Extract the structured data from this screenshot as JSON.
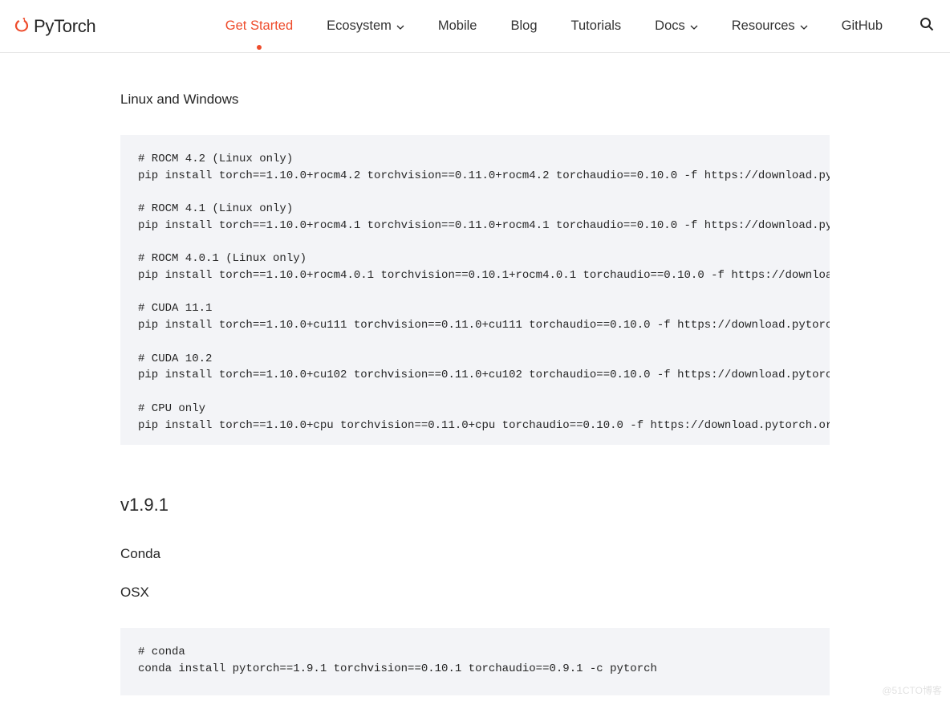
{
  "brand": "PyTorch",
  "nav": {
    "get_started": "Get Started",
    "ecosystem": "Ecosystem",
    "mobile": "Mobile",
    "blog": "Blog",
    "tutorials": "Tutorials",
    "docs": "Docs",
    "resources": "Resources",
    "github": "GitHub"
  },
  "sections": {
    "linux_windows": "Linux and Windows",
    "v191": "v1.9.1",
    "conda": "Conda",
    "osx": "OSX"
  },
  "code_block_1": "# ROCM 4.2 (Linux only)\npip install torch==1.10.0+rocm4.2 torchvision==0.11.0+rocm4.2 torchaudio==0.10.0 -f https://download.pytorch.org/whl/torch_stable.html\n\n# ROCM 4.1 (Linux only)\npip install torch==1.10.0+rocm4.1 torchvision==0.11.0+rocm4.1 torchaudio==0.10.0 -f https://download.pytorch.org/whl/torch_stable.html\n\n# ROCM 4.0.1 (Linux only)\npip install torch==1.10.0+rocm4.0.1 torchvision==0.10.1+rocm4.0.1 torchaudio==0.10.0 -f https://download.pytorch.org/whl/torch_stable.html\n\n# CUDA 11.1\npip install torch==1.10.0+cu111 torchvision==0.11.0+cu111 torchaudio==0.10.0 -f https://download.pytorch.org/whl/torch_stable.html\n\n# CUDA 10.2\npip install torch==1.10.0+cu102 torchvision==0.11.0+cu102 torchaudio==0.10.0 -f https://download.pytorch.org/whl/torch_stable.html\n\n# CPU only\npip install torch==1.10.0+cpu torchvision==0.11.0+cpu torchaudio==0.10.0 -f https://download.pytorch.org/whl/torch_stable.html",
  "code_block_2": "# conda\nconda install pytorch==1.9.1 torchvision==0.10.1 torchaudio==0.9.1 -c pytorch",
  "watermark": "@51CTO博客"
}
